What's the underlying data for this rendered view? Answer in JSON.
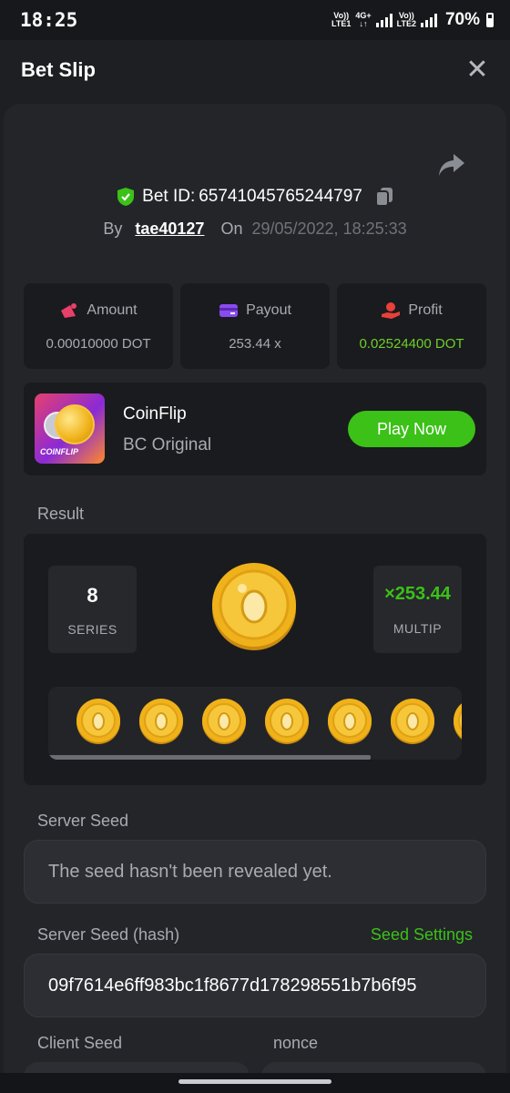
{
  "status_bar": {
    "time": "18:25",
    "network1_top": "Vo)) LTE1",
    "network_type": "4G+",
    "network2_top": "Vo)) LTE2",
    "battery": "70%"
  },
  "header": {
    "title": "Bet Slip",
    "close_icon": "close-icon"
  },
  "bet": {
    "id_label": "Bet ID:",
    "id_value": "65741045765244797",
    "by_label": "By",
    "user": "tae40127",
    "on_label": "On",
    "datetime": "29/05/2022, 18:25:33"
  },
  "stats": [
    {
      "label": "Amount",
      "value": "0.00010000 DOT",
      "icon": "amount-icon"
    },
    {
      "label": "Payout",
      "value": "253.44 x",
      "icon": "payout-card-icon"
    },
    {
      "label": "Profit",
      "value": "0.02524400 DOT",
      "icon": "profit-hand-icon"
    }
  ],
  "game": {
    "name": "CoinFlip",
    "subtitle": "BC Original",
    "thumb_label": "COINFLIP",
    "play_label": "Play Now"
  },
  "result": {
    "label": "Result",
    "series_value": "8",
    "series_label": "SERIES",
    "multiplier_value": "×253.44",
    "multiplier_label": "MULTIP",
    "coins_visible": 7
  },
  "server_seed": {
    "label": "Server Seed",
    "value": "The seed hasn't been revealed yet."
  },
  "server_seed_hash": {
    "label": "Server Seed (hash)",
    "settings_link": "Seed Settings",
    "value": "09f7614e6ff983bc1f8677d178298551b7b6f95"
  },
  "client_seed": {
    "label": "Client Seed"
  },
  "nonce": {
    "label": "nonce"
  },
  "colors": {
    "accent_green": "#3bc117",
    "profit_green": "#6ccf2a",
    "background": "#1e1f23",
    "card": "#1a1b1e"
  }
}
